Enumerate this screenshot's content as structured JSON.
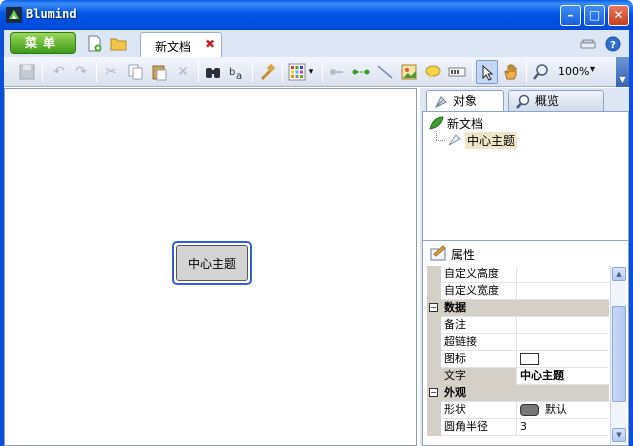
{
  "window": {
    "title": "Blumind",
    "minimize_glyph": "–",
    "maximize_glyph": "□",
    "close_glyph": "✕"
  },
  "tabbar": {
    "menu_label": "菜单",
    "active_doc_tab": "新文档",
    "close_tab_glyph": "✖"
  },
  "toolbar": {
    "zoom": "100%",
    "zoom_arrow": "▾",
    "overflow_glyph": "▼"
  },
  "canvas": {
    "central_topic": "中心主题"
  },
  "side_panel": {
    "tabs": [
      {
        "label": "对象"
      },
      {
        "label": "概览"
      }
    ],
    "tree": {
      "root": "新文档",
      "child": "中心主题"
    },
    "properties_title": "属性",
    "rows": [
      {
        "type": "item",
        "key": "自定义高度",
        "value": ""
      },
      {
        "type": "item",
        "key": "自定义宽度",
        "value": ""
      },
      {
        "type": "category",
        "key": "数据",
        "toggle": "−"
      },
      {
        "type": "item",
        "key": "备注",
        "value": ""
      },
      {
        "type": "item",
        "key": "超链接",
        "value": ""
      },
      {
        "type": "item",
        "key": "图标",
        "value": ""
      },
      {
        "type": "item",
        "key": "文字",
        "value": "中心主题"
      },
      {
        "type": "category",
        "key": "外观",
        "toggle": "−"
      },
      {
        "type": "item",
        "key": "形状",
        "value": "默认"
      },
      {
        "type": "item",
        "key": "圆角半径",
        "value": "3"
      }
    ]
  },
  "colors": {
    "titlebar": "#0055e5",
    "menu_button": "#3f9a1a",
    "topic_border": "#2f62d8",
    "topic_fill": "#d4d4d4"
  }
}
